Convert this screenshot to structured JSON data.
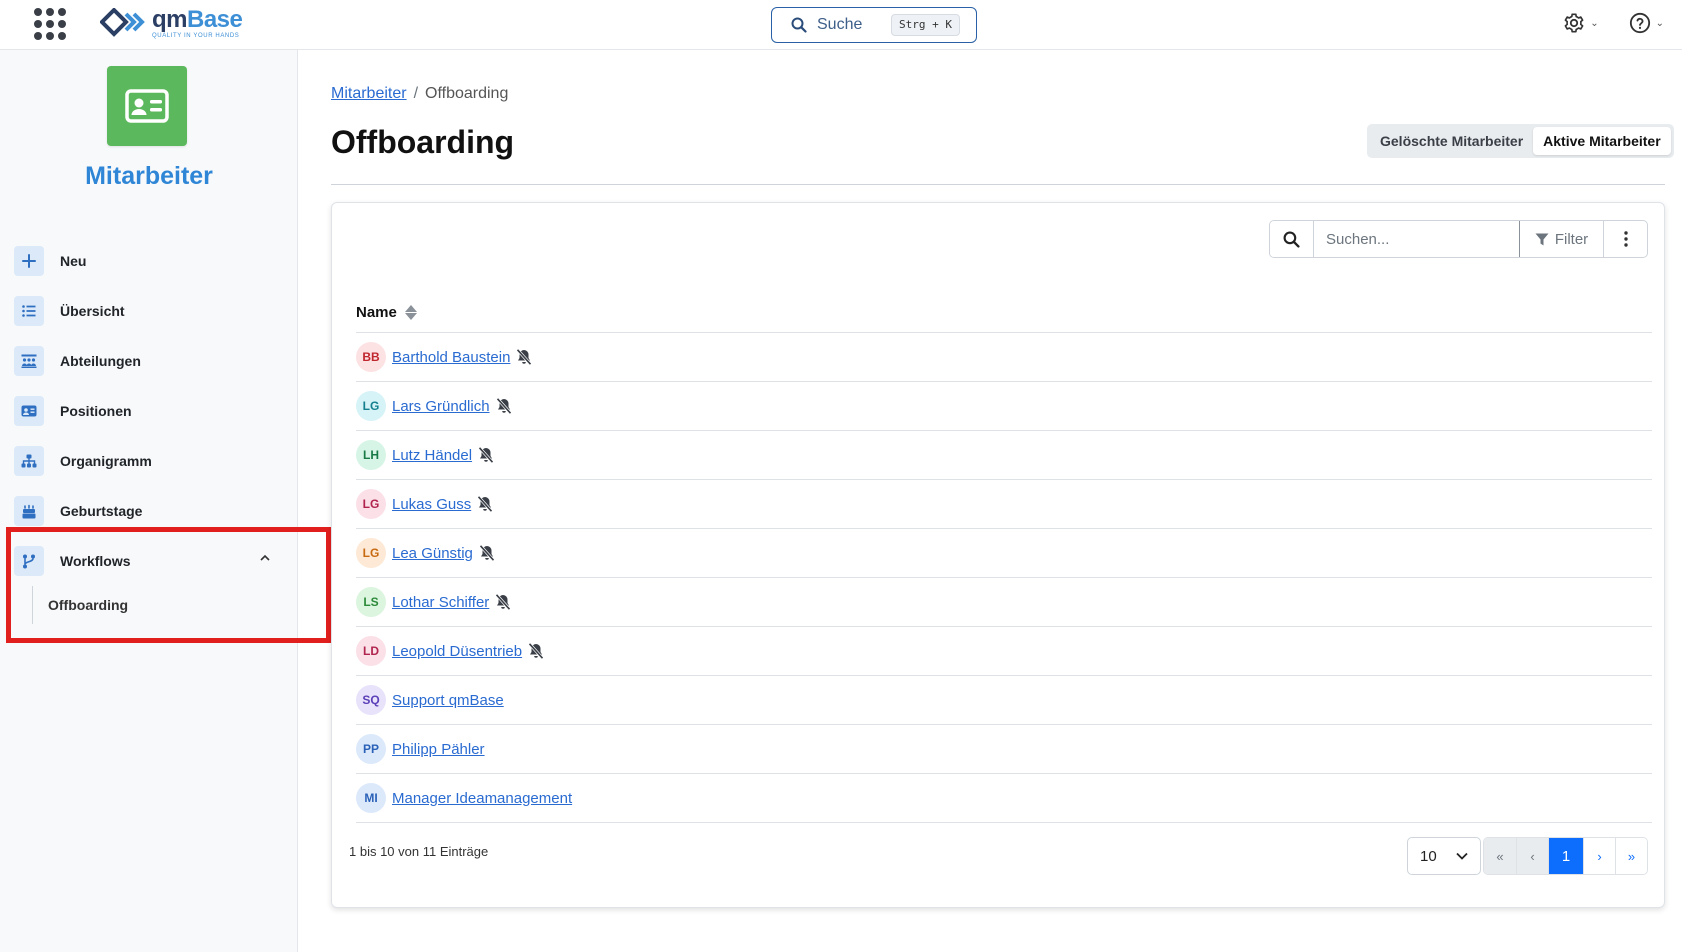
{
  "brand": {
    "name_part1": "qm",
    "name_part2": "Base",
    "tagline": "QUALITY IN YOUR HANDS"
  },
  "header": {
    "search_label": "Suche",
    "search_shortcut": "Strg + K"
  },
  "sidebar": {
    "app_title": "Mitarbeiter",
    "items": [
      {
        "label": "Neu",
        "icon": "plus-icon"
      },
      {
        "label": "Übersicht",
        "icon": "list-icon"
      },
      {
        "label": "Abteilungen",
        "icon": "departments-icon"
      },
      {
        "label": "Positionen",
        "icon": "id-card-icon"
      },
      {
        "label": "Organigramm",
        "icon": "sitemap-icon"
      },
      {
        "label": "Geburtstage",
        "icon": "cake-icon"
      },
      {
        "label": "Workflows",
        "icon": "branch-icon"
      }
    ],
    "subitems": [
      {
        "label": "Offboarding"
      }
    ]
  },
  "breadcrumb": {
    "parent": "Mitarbeiter",
    "separator": "/",
    "current": "Offboarding"
  },
  "page": {
    "title": "Offboarding",
    "toggle": {
      "option1": "Gelöschte Mitarbeiter",
      "option2": "Aktive Mitarbeiter",
      "selected": "Aktive Mitarbeiter"
    }
  },
  "table": {
    "search_placeholder": "Suchen...",
    "filter_label": "Filter",
    "column_name": "Name",
    "rows": [
      {
        "initials": "BB",
        "name": "Barthold Baustein",
        "muted": true,
        "bg": "#fde2e4",
        "fg": "#c0262e"
      },
      {
        "initials": "LG",
        "name": "Lars Gründlich",
        "muted": true,
        "bg": "#d6f3f7",
        "fg": "#16808f"
      },
      {
        "initials": "LH",
        "name": "Lutz Händel",
        "muted": true,
        "bg": "#d7f5e6",
        "fg": "#197a47"
      },
      {
        "initials": "LG",
        "name": "Lukas Guss",
        "muted": true,
        "bg": "#fbe0e8",
        "fg": "#b0244e"
      },
      {
        "initials": "LG",
        "name": "Lea Günstig",
        "muted": true,
        "bg": "#fde9d6",
        "fg": "#c86a12"
      },
      {
        "initials": "LS",
        "name": "Lothar Schiffer",
        "muted": true,
        "bg": "#dcf5df",
        "fg": "#2d8a3a"
      },
      {
        "initials": "LD",
        "name": "Leopold Düsentrieb",
        "muted": true,
        "bg": "#fbe0e8",
        "fg": "#b0244e"
      },
      {
        "initials": "SQ",
        "name": "Support qmBase",
        "muted": false,
        "bg": "#e8e2fb",
        "fg": "#5b3fb8"
      },
      {
        "initials": "PP",
        "name": "Philipp Pähler",
        "muted": false,
        "bg": "#dbe9fb",
        "fg": "#2b62b8"
      },
      {
        "initials": "MI",
        "name": "Manager Ideamanagement",
        "muted": false,
        "bg": "#dbe9fb",
        "fg": "#2b62b8"
      }
    ],
    "info": "1 bis 10 von 11 Einträge",
    "page_size": "10",
    "pagination": {
      "first": "«",
      "prev": "‹",
      "current": "1",
      "next": "›",
      "last": "»"
    }
  },
  "colors": {
    "accent": "#2f86d6",
    "primary": "#0d6efd",
    "app_tile": "#5cb85c",
    "highlight": "#e1201e"
  }
}
